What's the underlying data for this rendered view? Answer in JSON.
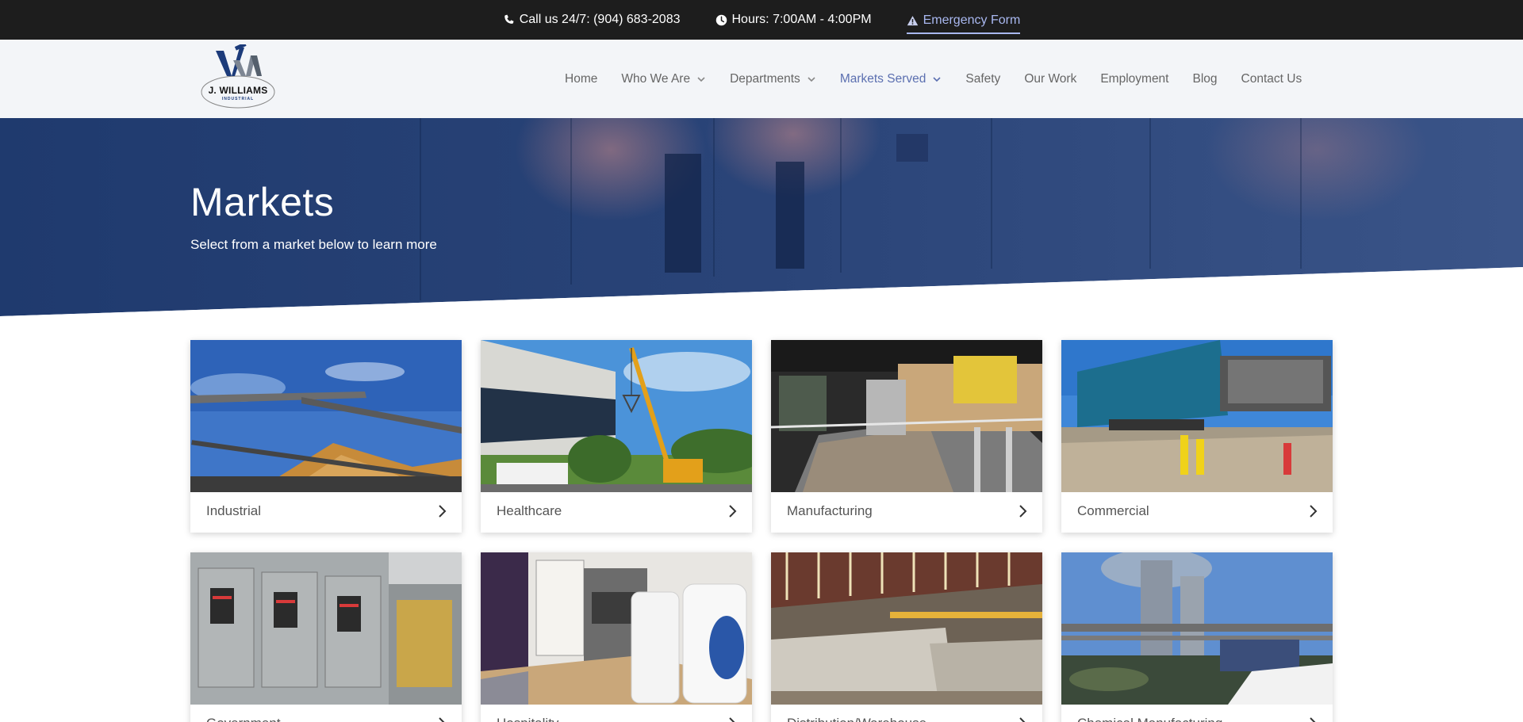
{
  "topbar": {
    "phone_label": "Call us 24/7: (904) 683-2083",
    "hours_label": "Hours: 7:00AM - 4:00PM",
    "emergency_label": "Emergency Form",
    "phone_icon": "phone-icon",
    "hours_icon": "clock-icon",
    "emergency_icon": "warning-icon"
  },
  "header": {
    "logo_text": "J. WILLIAMS",
    "logo_subtext": "INDUSTRIAL",
    "nav": [
      {
        "label": "Home",
        "has_dropdown": false
      },
      {
        "label": "Who We Are",
        "has_dropdown": true
      },
      {
        "label": "Departments",
        "has_dropdown": true
      },
      {
        "label": "Markets Served",
        "has_dropdown": true,
        "active": true
      },
      {
        "label": "Safety",
        "has_dropdown": false
      },
      {
        "label": "Our Work",
        "has_dropdown": false
      },
      {
        "label": "Employment",
        "has_dropdown": false
      },
      {
        "label": "Blog",
        "has_dropdown": false
      },
      {
        "label": "Contact Us",
        "has_dropdown": false
      }
    ]
  },
  "hero": {
    "title": "Markets",
    "subtitle": "Select from a market below to learn more"
  },
  "markets": [
    {
      "label": "Industrial"
    },
    {
      "label": "Healthcare"
    },
    {
      "label": "Manufacturing"
    },
    {
      "label": "Commercial"
    },
    {
      "label": "Government"
    },
    {
      "label": "Hospitality"
    },
    {
      "label": "Distribution/Warehouse"
    },
    {
      "label": "Chemical Manufacturing"
    }
  ],
  "colors": {
    "topbar_bg": "#1d1d1d",
    "header_bg": "#f3f5f8",
    "hero_overlay": "#1f3a6e",
    "nav_active": "#5b6fb0",
    "emergency_link": "#a9b8f0"
  }
}
